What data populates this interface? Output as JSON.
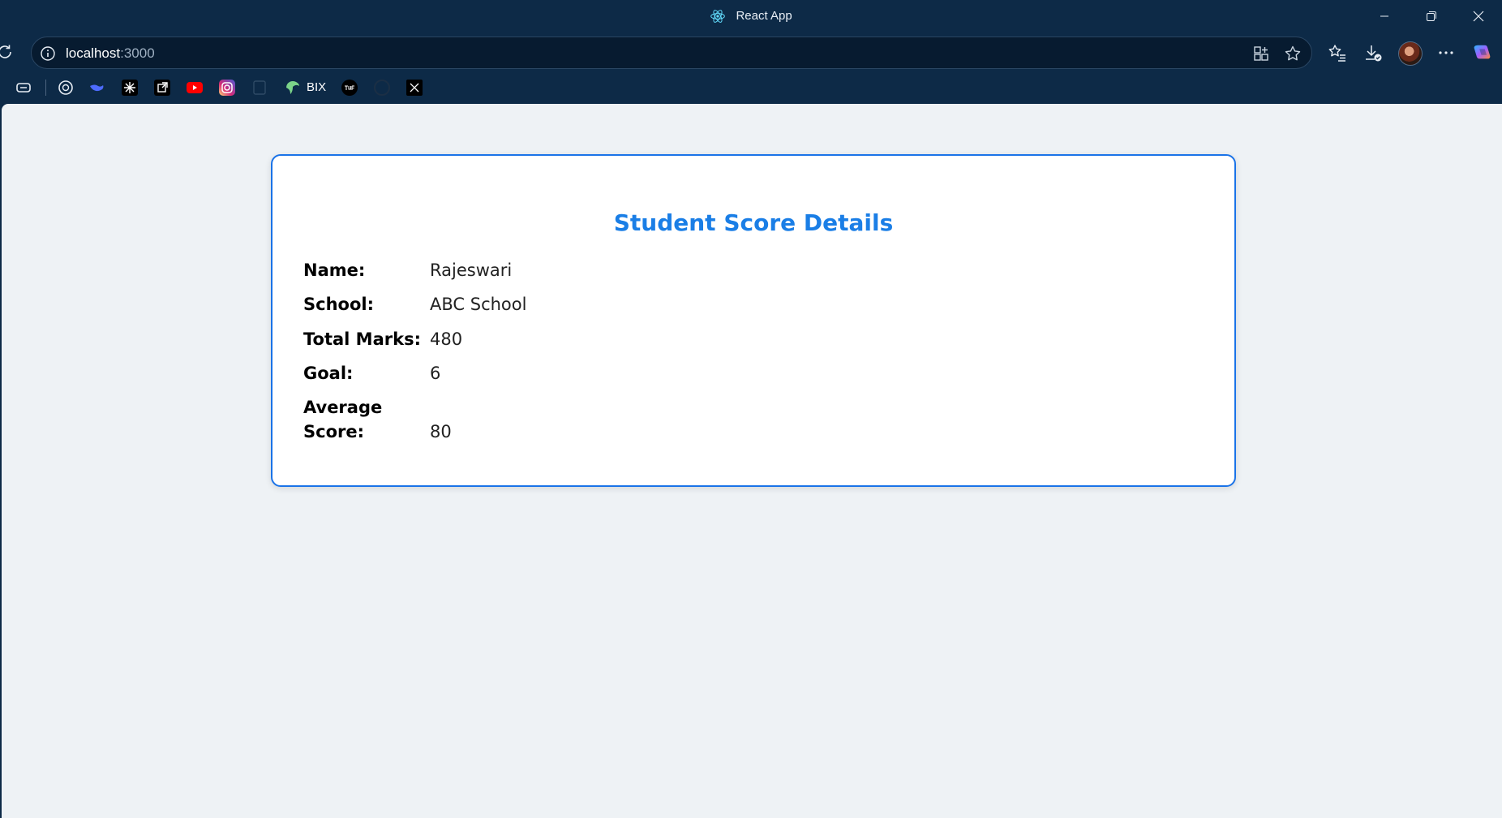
{
  "window": {
    "title": "React App"
  },
  "address_bar": {
    "host": "localhost",
    "port": ":3000"
  },
  "bookmarks": {
    "bix_label": "BIX"
  },
  "card": {
    "title": "Student Score Details",
    "rows": [
      {
        "label": "Name:",
        "value": "Rajeswari"
      },
      {
        "label": "School:",
        "value": "ABC School"
      },
      {
        "label": "Total Marks:",
        "value": "480"
      },
      {
        "label": "Goal:",
        "value": "6"
      },
      {
        "label": "Average Score:",
        "value": "80"
      }
    ]
  },
  "colors": {
    "chrome_bg": "#0d2a47",
    "accent": "#1a73e8",
    "page_bg": "#eef2f5"
  }
}
